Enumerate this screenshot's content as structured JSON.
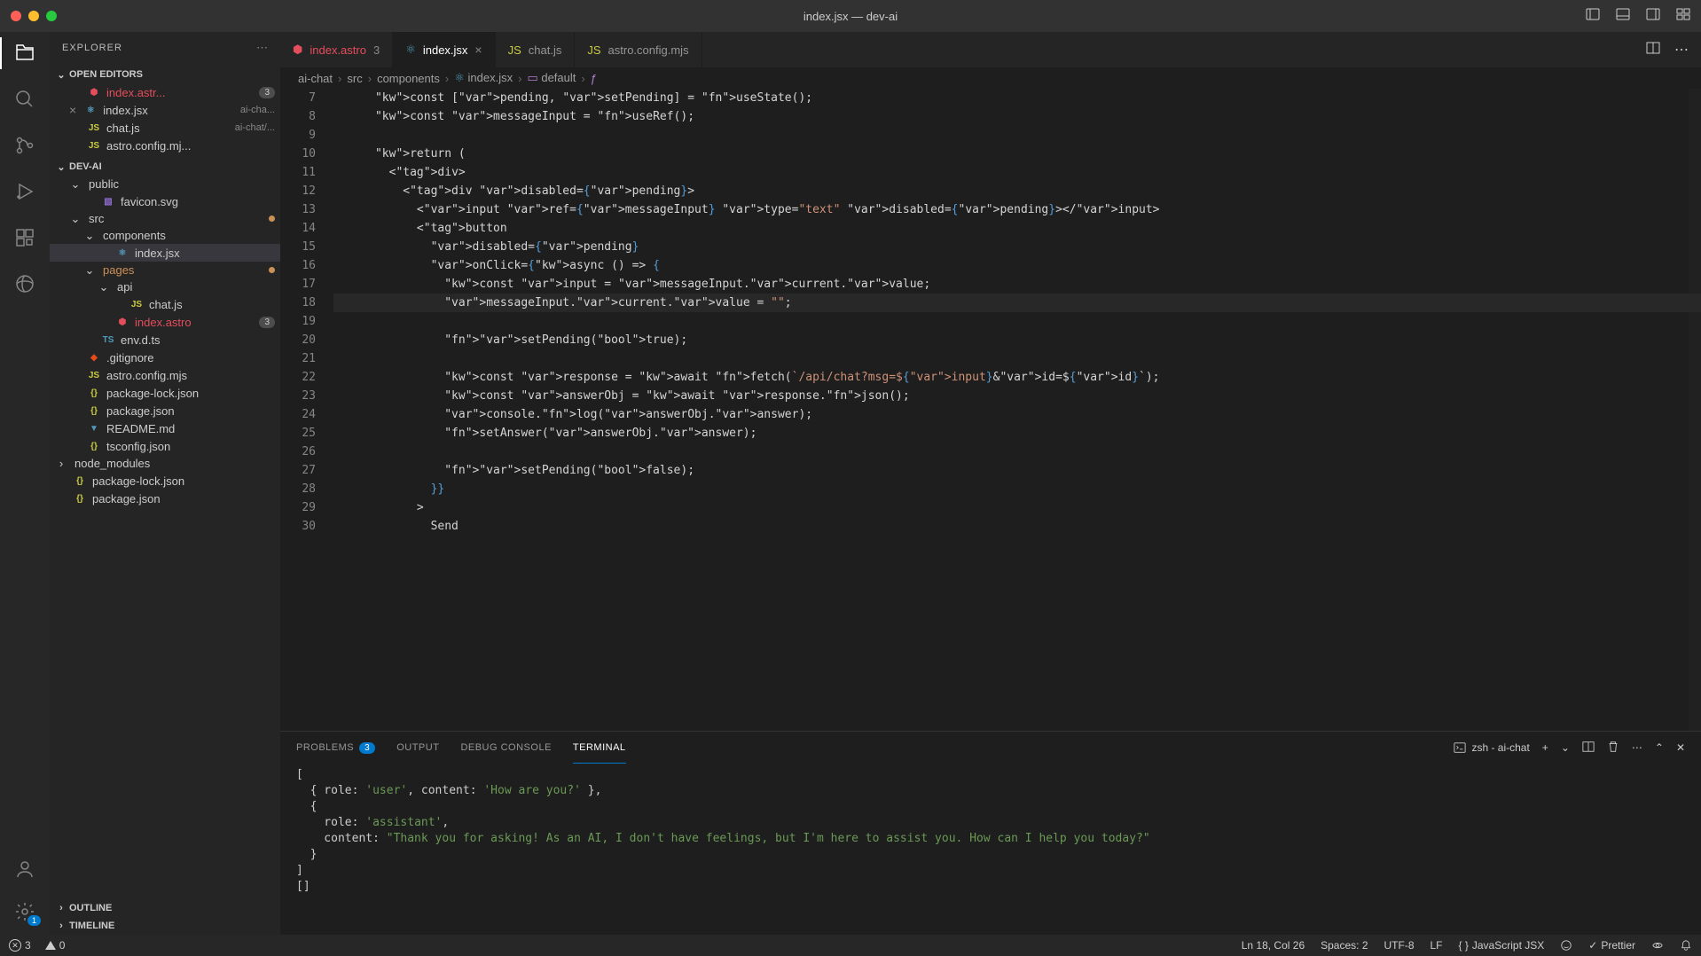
{
  "window": {
    "title": "index.jsx — dev-ai"
  },
  "sidebar": {
    "title": "EXPLORER",
    "sections": {
      "openEditors": "OPEN EDITORS",
      "workspace": "DEV-AI",
      "outline": "OUTLINE",
      "timeline": "TIMELINE"
    }
  },
  "openEditors": [
    {
      "name": "index.astr...",
      "badge": "3",
      "icon": "astro"
    },
    {
      "name": "index.jsx",
      "secondary": "ai-cha...",
      "icon": "jsx",
      "close": true
    },
    {
      "name": "chat.js",
      "secondary": "ai-chat/...",
      "icon": "js"
    },
    {
      "name": "astro.config.mj...",
      "icon": "js"
    }
  ],
  "files": [
    {
      "name": "public",
      "type": "folder",
      "indent": 1
    },
    {
      "name": "favicon.svg",
      "type": "svg",
      "indent": 2
    },
    {
      "name": "src",
      "type": "folder",
      "indent": 1,
      "modified": true
    },
    {
      "name": "components",
      "type": "folder",
      "indent": 2
    },
    {
      "name": "index.jsx",
      "type": "jsx",
      "indent": 3,
      "selected": true
    },
    {
      "name": "pages",
      "type": "folder",
      "indent": 2,
      "modified": true,
      "colored": true
    },
    {
      "name": "api",
      "type": "folder",
      "indent": 3
    },
    {
      "name": "chat.js",
      "type": "js",
      "indent": 4
    },
    {
      "name": "index.astro",
      "type": "astro",
      "indent": 3,
      "badge": "3",
      "error": true
    },
    {
      "name": "env.d.ts",
      "type": "ts",
      "indent": 2
    },
    {
      "name": ".gitignore",
      "type": "git",
      "indent": 1
    },
    {
      "name": "astro.config.mjs",
      "type": "js",
      "indent": 1
    },
    {
      "name": "package-lock.json",
      "type": "json",
      "indent": 1
    },
    {
      "name": "package.json",
      "type": "json",
      "indent": 1
    },
    {
      "name": "README.md",
      "type": "md",
      "indent": 1
    },
    {
      "name": "tsconfig.json",
      "type": "json",
      "indent": 1
    },
    {
      "name": "node_modules",
      "type": "folder-closed",
      "indent": 0
    },
    {
      "name": "package-lock.json",
      "type": "json",
      "indent": 0
    },
    {
      "name": "package.json",
      "type": "json",
      "indent": 0
    }
  ],
  "tabs": [
    {
      "name": "index.astro",
      "icon": "astro",
      "badge": "3"
    },
    {
      "name": "index.jsx",
      "icon": "jsx",
      "active": true
    },
    {
      "name": "chat.js",
      "icon": "js"
    },
    {
      "name": "astro.config.mjs",
      "icon": "js"
    }
  ],
  "breadcrumb": [
    "ai-chat",
    "src",
    "components",
    "index.jsx",
    "default",
    "<function>"
  ],
  "code": {
    "startLine": 7,
    "lines": [
      "      const [pending, setPending] = useState();",
      "      const messageInput = useRef();",
      "",
      "      return (",
      "        <div>",
      "          <div disabled={pending}>",
      "            <input ref={messageInput} type=\"text\" disabled={pending}></input>",
      "            <button",
      "              disabled={pending}",
      "              onClick={async () => {",
      "                const input = messageInput.current.value;",
      "                messageInput.current.value = \"\";",
      "",
      "                setPending(true);",
      "",
      "                const response = await fetch(`/api/chat?msg=${input}&id=${id}`);",
      "                const answerObj = await response.json();",
      "                console.log(answerObj.answer);",
      "                setAnswer(answerObj.answer);",
      "",
      "                setPending(false);",
      "              }}",
      "            >",
      "              Send"
    ],
    "highlightedLine": 18
  },
  "panel": {
    "tabs": {
      "problems": "PROBLEMS",
      "output": "OUTPUT",
      "debug": "DEBUG CONSOLE",
      "terminal": "TERMINAL"
    },
    "problemsBadge": "3",
    "terminalLabel": "zsh - ai-chat"
  },
  "terminal": [
    "[",
    "  { role: 'user', content: 'How are you?' },",
    "  {",
    "    role: 'assistant',",
    "    content: \"Thank you for asking! As an AI, I don't have feelings, but I'm here to assist you. How can I help you today?\"",
    "  }",
    "]",
    "[]"
  ],
  "statusbar": {
    "errors": "3",
    "warnings": "0",
    "cursor": "Ln 18, Col 26",
    "spaces": "Spaces: 2",
    "encoding": "UTF-8",
    "eol": "LF",
    "language": "JavaScript JSX",
    "prettier": "Prettier",
    "gearBadge": "1"
  }
}
